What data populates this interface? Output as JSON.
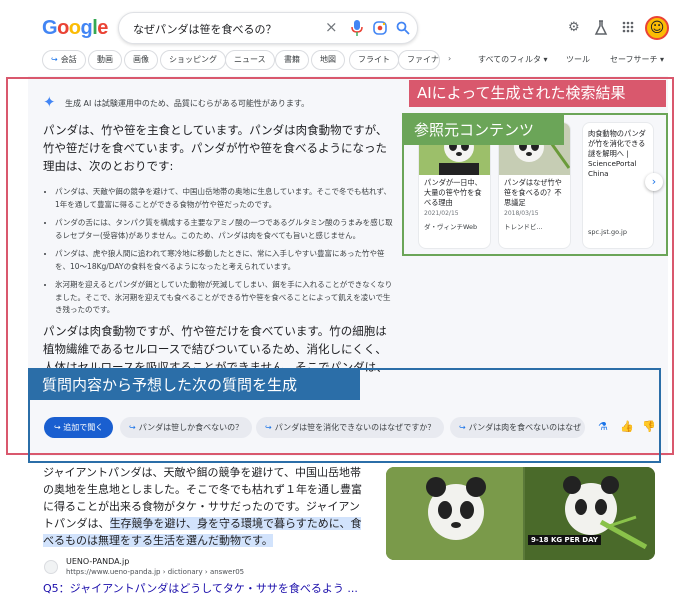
{
  "header": {
    "logo": "Google",
    "search_query": "なぜパンダは笹を食べるの？",
    "clear_icon": "×"
  },
  "chips": [
    {
      "label": "会話",
      "ai": true
    },
    {
      "label": "動画"
    },
    {
      "label": "画像"
    },
    {
      "label": "ショッピング"
    },
    {
      "label": "ニュース"
    },
    {
      "label": "書籍"
    },
    {
      "label": "地図"
    },
    {
      "label": "フライト"
    },
    {
      "label": "ファイナ"
    }
  ],
  "toolbar": {
    "all_filters": "すべてのフィルタ ▾",
    "tools": "ツール",
    "safesearch": "セーフサーチ ▾"
  },
  "annotations": {
    "ai_generated": "AIによって生成された検索結果",
    "sources": "参照元コンテンツ",
    "followup": "質問内容から予想した次の質問を生成"
  },
  "ai_overview": {
    "disclaimer": "生成 AI は試験運用中のため、品質にむらがある可能性があります。",
    "intro": "パンダは、竹や笹を主食としています。パンダは肉食動物ですが、竹や笹だけを食べています。パンダが竹や笹を食べるようになった理由は、次のとおりです:",
    "bullets": [
      "パンダは、天敵や餌の競争を避けて、中国山岳地帯の奥地に生息しています。そこで冬でも枯れず、1年を通して豊富に得ることができる食物が竹や笹だったのです。",
      "パンダの舌には、タンパク質を構成する主要なアミノ酸の一つであるグルタミン酸のうまみを感じ取るレセプター(受容体)がありません。このため、パンダは肉を食べても旨いと感じません。",
      "パンダは、虎や狼人間に追われて寒冷地に移動したときに、常に入手しやすい豊富にあった竹や笹を、10～18Kg/DAYの食料を食べるようになったと考えられています。",
      "氷河期を迎えるとパンダが餌としていた動物が死滅してしまい、餌を手に入れることができなくなりました。そこで、氷河期を迎えても食べることができる竹や笹を食べることによって飢えを凌いで生き残ったのです。"
    ],
    "outro": "パンダは肉食動物ですが、竹や笹だけを食べています。竹の細胞は植物繊維であるセルロースで結びついているため、消化しにくく、人体はセルロースを吸収することができません。そこでパンダは、腸内細菌が竹の葉っぱを分解することによって栄養分を得ています。"
  },
  "sources": [
    {
      "title": "パンダが一日中、大量の笹や竹を食べる理由",
      "date": "2021/02/15",
      "site": "ダ・ヴィンチWeb"
    },
    {
      "title": "パンダはなぜ竹や笹を食べるの？不思議足",
      "date": "2018/03/15",
      "site": "トレンドビ..."
    },
    {
      "title": "肉食動物のパンダが竹を消化できる謎を解明へ | SciencePortal China",
      "date": "",
      "site": "spc.jst.go.jp"
    }
  ],
  "followup": {
    "ask_label": "追加で聞く",
    "suggestions": [
      "パンダは笹しか食べないの？",
      "パンダは笹を消化できないのはなぜですか？",
      "パンダは肉を食べないのはなぜ"
    ]
  },
  "result": {
    "snippet_plain": "ジャイアントパンダは、天敵や餌の競争を避けて、中国山岳地帯の奥地を生息地としました。そこで冬でも枯れず１年を通し豊富に得ることが出来る食物がタケ・ササだったのです。ジャイアントパンダは、",
    "snippet_highlight": "生存競争を避け、身を守る環境で暮らすために、食べるものは無理をする生活を選んだ動物です。",
    "site": "UENO-PANDA.jp",
    "url": "https://www.ueno-panda.jp › dictionary › answer05",
    "title": "Q5：ジャイアントパンダはどうしてタケ・ササを食べるよう ...",
    "image_badge": "9-18 KG PER DAY"
  }
}
